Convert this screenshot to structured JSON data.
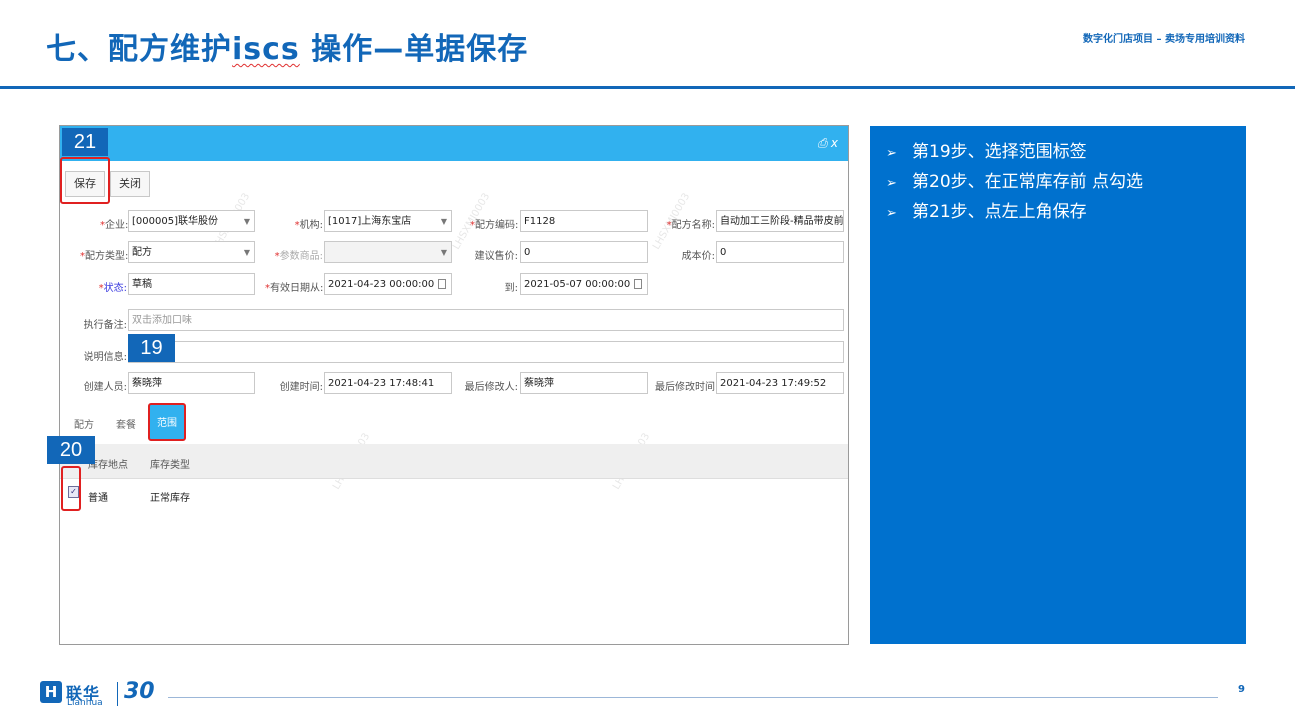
{
  "slide": {
    "title_prefix": "七、配方维护",
    "title_wavy": "iscs",
    "title_suffix": " 操作—单据保存",
    "subtitle": "数字化门店项目 – 卖场专用培训资料",
    "page_number": "9"
  },
  "window": {
    "controls": "⎙ x",
    "toolbar": {
      "save_label": "保存",
      "close_label": "关闭"
    }
  },
  "form": {
    "enterprise": {
      "label": "企业:",
      "value": "[000005]联华股份"
    },
    "org": {
      "label": "机构:",
      "value": "[1017]上海东宝店"
    },
    "recipe_code": {
      "label": "配方编码:",
      "value": "F1128"
    },
    "recipe_name": {
      "label": "配方名称:",
      "value": "自动加工三阶段-精品带皮前腿肉"
    },
    "recipe_type": {
      "label": "配方类型:",
      "value": "配方"
    },
    "ref_product": {
      "label": "参数商品:",
      "value": ""
    },
    "suggest_price": {
      "label": "建议售价:",
      "value": "0"
    },
    "cost_price": {
      "label": "成本价:",
      "value": "0"
    },
    "status": {
      "label": "状态:",
      "value": "草稿"
    },
    "valid_from": {
      "label": "有效日期从:",
      "value": "2021-04-23 00:00:00"
    },
    "valid_to": {
      "label": "到:",
      "value": "2021-05-07 00:00:00"
    },
    "exec_note": {
      "label": "执行备注:",
      "placeholder": "双击添加口味"
    },
    "desc": {
      "label": "说明信息:",
      "value": ""
    },
    "creator": {
      "label": "创建人员:",
      "value": "蔡晓萍"
    },
    "created_at": {
      "label": "创建时间:",
      "value": "2021-04-23 17:48:41"
    },
    "modifier": {
      "label": "最后修改人:",
      "value": "蔡晓萍"
    },
    "modified_at": {
      "label": "最后修改时间:",
      "value": "2021-04-23 17:49:52"
    }
  },
  "tabs": [
    {
      "label": "配方",
      "active": false
    },
    {
      "label": "套餐",
      "active": false
    },
    {
      "label": "范围",
      "active": true
    }
  ],
  "grid": {
    "headers": [
      "库存地点",
      "库存类型"
    ],
    "rows": [
      {
        "checked": true,
        "check_mark": "✓",
        "location": "普通",
        "type": "正常库存"
      }
    ]
  },
  "steps": {
    "s21": "21",
    "s19": "19",
    "s20": "20"
  },
  "instructions": {
    "arrow": "➢",
    "items": [
      "第19步、选择范围标签",
      "第20步、在正常库存前 点勾选",
      "第21步、点左上角保存"
    ]
  },
  "logo": {
    "box": "H",
    "cn": "联华",
    "en": "Lianhua",
    "badge": "30"
  },
  "colors": {
    "brand": "#1267b8",
    "header_bar": "#31b1ef",
    "panel": "#0071ce",
    "highlight": "#e02020"
  }
}
